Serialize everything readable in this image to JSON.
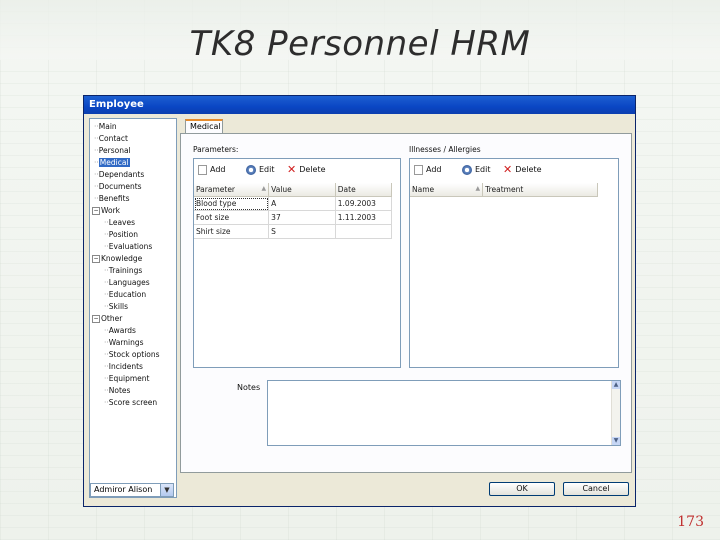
{
  "slide": {
    "title": "TK8 Personnel HRM",
    "page_number": "173"
  },
  "window": {
    "title": "Employee"
  },
  "tree": [
    {
      "label": "Main",
      "indent": 1,
      "node": "leaf"
    },
    {
      "label": "Contact",
      "indent": 1,
      "node": "leaf"
    },
    {
      "label": "Personal",
      "indent": 1,
      "node": "leaf"
    },
    {
      "label": "Medical",
      "indent": 1,
      "node": "leaf",
      "selected": true
    },
    {
      "label": "Dependants",
      "indent": 1,
      "node": "leaf"
    },
    {
      "label": "Documents",
      "indent": 1,
      "node": "leaf"
    },
    {
      "label": "Benefits",
      "indent": 1,
      "node": "leaf"
    },
    {
      "label": "Work",
      "indent": 0,
      "node": "expanded"
    },
    {
      "label": "Leaves",
      "indent": 2,
      "node": "leaf"
    },
    {
      "label": "Position",
      "indent": 2,
      "node": "leaf"
    },
    {
      "label": "Evaluations",
      "indent": 2,
      "node": "leaf"
    },
    {
      "label": "Knowledge",
      "indent": 0,
      "node": "expanded"
    },
    {
      "label": "Trainings",
      "indent": 2,
      "node": "leaf"
    },
    {
      "label": "Languages",
      "indent": 2,
      "node": "leaf"
    },
    {
      "label": "Education",
      "indent": 2,
      "node": "leaf"
    },
    {
      "label": "Skills",
      "indent": 2,
      "node": "leaf"
    },
    {
      "label": "Other",
      "indent": 0,
      "node": "expanded"
    },
    {
      "label": "Awards",
      "indent": 2,
      "node": "leaf"
    },
    {
      "label": "Warnings",
      "indent": 2,
      "node": "leaf"
    },
    {
      "label": "Stock options",
      "indent": 2,
      "node": "leaf"
    },
    {
      "label": "Incidents",
      "indent": 2,
      "node": "leaf"
    },
    {
      "label": "Equipment",
      "indent": 2,
      "node": "leaf"
    },
    {
      "label": "Notes",
      "indent": 2,
      "node": "leaf"
    },
    {
      "label": "Score screen",
      "indent": 2,
      "node": "leaf"
    }
  ],
  "user_select": {
    "value": "Admiror Alison"
  },
  "tab": {
    "label": "Medical"
  },
  "parameters": {
    "label": "Parameters:",
    "add_label": "Add",
    "edit_label": "Edit",
    "delete_label": "Delete",
    "columns": [
      "Parameter",
      "Value",
      "Date"
    ],
    "rows": [
      [
        "Blood type",
        "A",
        "1.09.2003"
      ],
      [
        "Foot size",
        "37",
        "1.11.2003"
      ],
      [
        "Shirt size",
        "S",
        ""
      ]
    ]
  },
  "illnesses": {
    "label": "Illnesses / Allergies",
    "add_label": "Add",
    "edit_label": "Edit",
    "delete_label": "Delete",
    "columns": [
      "Name",
      "Treatment"
    ]
  },
  "notes": {
    "label": "Notes"
  },
  "buttons": {
    "ok": "OK",
    "cancel": "Cancel"
  }
}
